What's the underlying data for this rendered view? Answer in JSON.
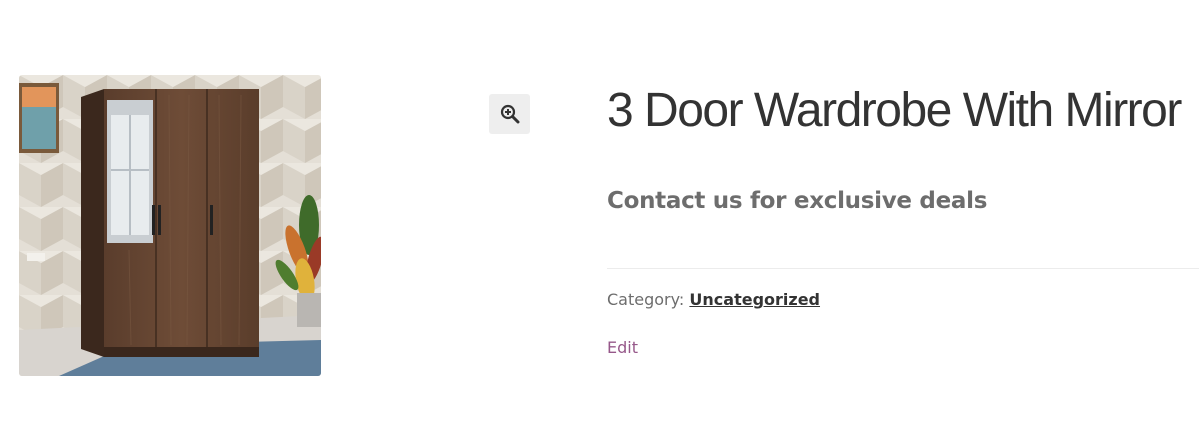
{
  "product": {
    "title": "3 Door Wardrobe With Mirror",
    "short_description": "Contact us for exclusive deals",
    "category_label": "Category:",
    "category_value": "Uncategorized",
    "edit_label": "Edit"
  },
  "gallery": {
    "zoom_icon": "magnifier-plus-icon",
    "image_subject": "wardrobe-photo"
  },
  "colors": {
    "title": "#333333",
    "body_text": "#6d6d6d",
    "link_accent": "#96588a",
    "zoom_bg": "#eeeeee",
    "divider": "#ececec"
  }
}
